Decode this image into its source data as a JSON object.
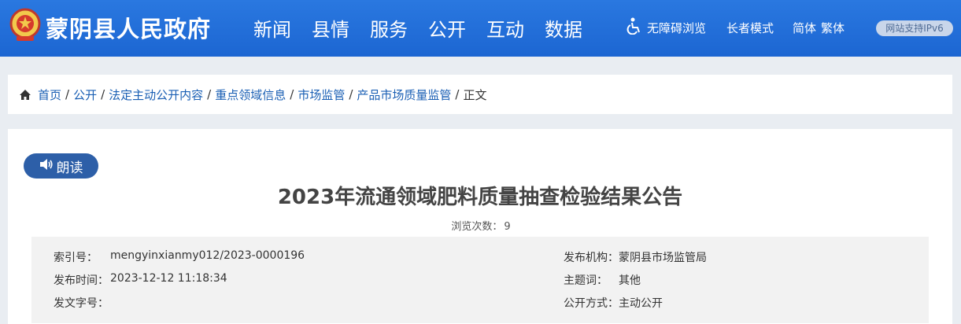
{
  "header": {
    "site_title": "蒙阴县人民政府",
    "nav": [
      "新闻",
      "县情",
      "服务",
      "公开",
      "互动",
      "数据"
    ],
    "accessibility": "无障碍浏览",
    "elder_mode": "长者模式",
    "simplified": "简体",
    "traditional": "繁体",
    "ipv6_badge": "网站支持IPv6",
    "bg_color": "#1f6bd6"
  },
  "breadcrumb": {
    "home": "首页",
    "items": [
      "公开",
      "法定主动公开内容",
      "重点领域信息",
      "市场监管",
      "产品市场质量监管"
    ],
    "current": "正文",
    "separator": "/"
  },
  "article": {
    "read_button": "朗读",
    "title": "2023年流通领域肥料质量抽查检验结果公告",
    "views_label": "浏览次数：",
    "views_count": "9"
  },
  "meta": {
    "index_label": "索引号：",
    "index_value": "mengyinxianmy012/2023-0000196",
    "publisher_label": "发布机构：",
    "publisher_value": "蒙阴县市场监管局",
    "time_label": "发布时间：",
    "time_value": "2023-12-12 11:18:34",
    "subject_label": "主题词：",
    "subject_value": "其他",
    "doc_no_label": "发文字号：",
    "doc_no_value": "",
    "disclosure_label": "公开方式：",
    "disclosure_value": "主动公开"
  }
}
